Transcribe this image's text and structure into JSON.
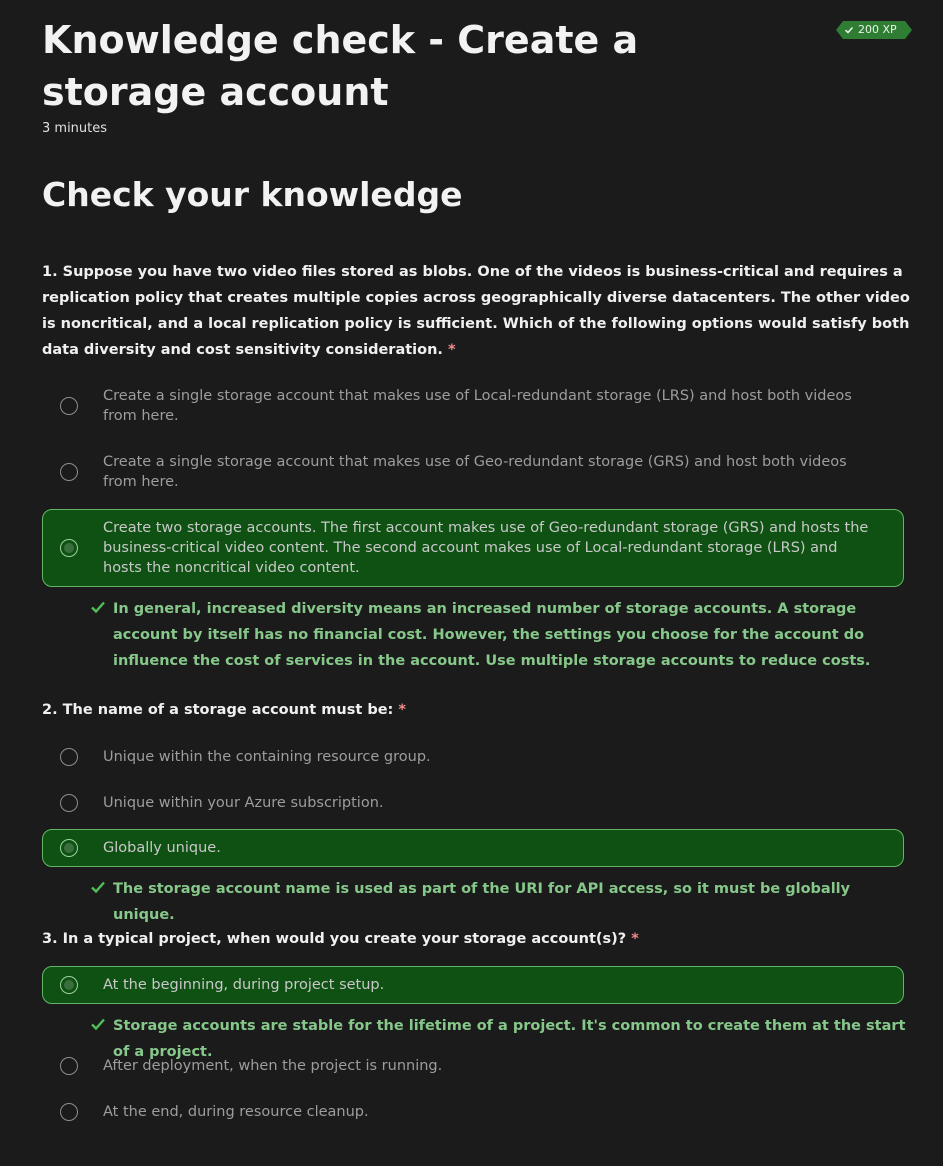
{
  "header": {
    "title": "Knowledge check - Create a storage account",
    "duration": "3 minutes",
    "xp": "200 XP"
  },
  "section_title": "Check your knowledge",
  "questions": [
    {
      "text": "1. Suppose you have two video files stored as blobs. One of the videos is business-critical and requires a replication policy that creates multiple copies across geographically diverse datacenters. The other video is noncritical, and a local replication policy is sufficient. Which of the following options would satisfy both data diversity and cost sensitivity consideration.",
      "required_marker": "*",
      "options": [
        "Create a single storage account that makes use of Local-redundant storage (LRS) and host both videos from here.",
        "Create a single storage account that makes use of Geo-redundant storage (GRS) and host both videos from here.",
        "Create two storage accounts. The first account makes use of Geo-redundant storage (GRS) and hosts the business-critical video content. The second account makes use of Local-redundant storage (LRS) and hosts the noncritical video content."
      ],
      "selected_index": 2,
      "feedback": "In general, increased diversity means an increased number of storage accounts. A storage account by itself has no financial cost. However, the settings you choose for the account do influence the cost of services in the account. Use multiple storage accounts to reduce costs."
    },
    {
      "text": "2. The name of a storage account must be:",
      "required_marker": "*",
      "options": [
        "Unique within the containing resource group.",
        "Unique within your Azure subscription.",
        "Globally unique."
      ],
      "selected_index": 2,
      "feedback": "The storage account name is used as part of the URI for API access, so it must be globally unique."
    },
    {
      "text": "3. In a typical project, when would you create your storage account(s)?",
      "required_marker": "*",
      "options": [
        "At the beginning, during project setup.",
        "After deployment, when the project is running.",
        "At the end, during resource cleanup."
      ],
      "selected_index": 0,
      "feedback": "Storage accounts are stable for the lifetime of a project. It's common to create them at the start of a project."
    }
  ],
  "colors": {
    "background": "#1b1b1b",
    "selected_bg": "#0f5113",
    "selected_border": "#64b467",
    "feedback_text": "#86c78a",
    "required_marker": "#f48b8b",
    "xp_badge": "#2e7d32"
  },
  "icons": {
    "feedback": "check-icon",
    "xp": "check-circle-icon"
  }
}
